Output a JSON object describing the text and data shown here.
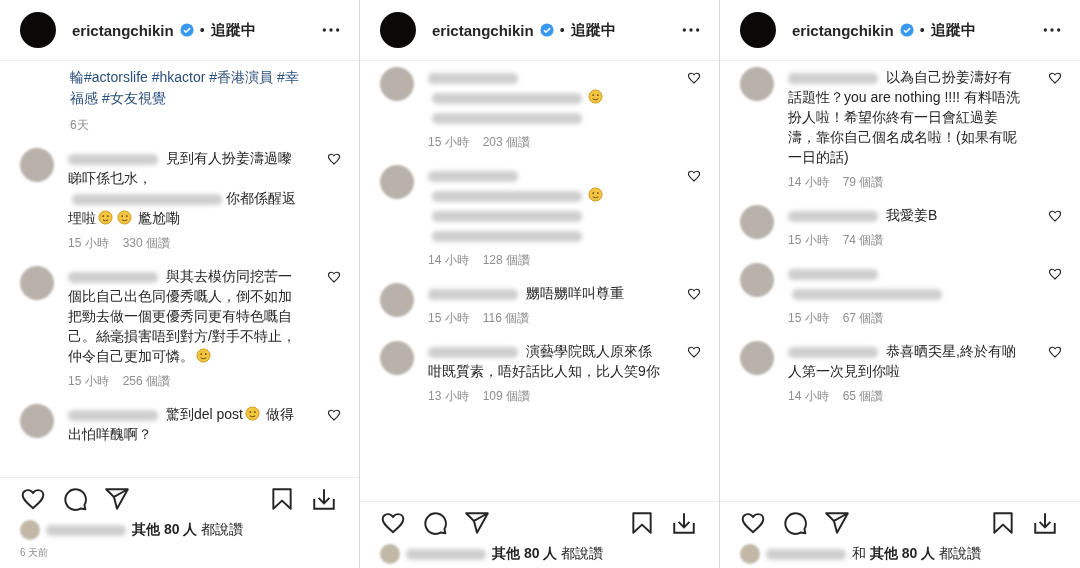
{
  "panels": [
    {
      "header": {
        "username": "erictangchikin",
        "separator": "•",
        "follow_status": "追蹤中"
      },
      "caption": "輪#actorslife #hkactor #香港演員 #幸福感 #女友視覺",
      "caption_time": "6天",
      "comments": [
        {
          "segments": [
            {
              "kind": "text",
              "text": "見到有人扮姜濤過嚟睇吓係乜水，"
            },
            {
              "kind": "blur"
            },
            {
              "kind": "text",
              "text": "你都係醒返埋啦"
            },
            {
              "kind": "emoji"
            },
            {
              "kind": "emoji"
            },
            {
              "kind": "text",
              "text": " 尷尬嘞"
            }
          ],
          "time": "15 小時",
          "likes": "330 個讚"
        },
        {
          "segments": [
            {
              "kind": "text",
              "text": "與其去模仿同挖苦一個比自己出色同優秀嘅人，倒不如加把勁去做一個更優秀同更有特色嘅自己。絲毫損害唔到對方/對手不特止，仲令自己更加可憐。"
            },
            {
              "kind": "emoji"
            }
          ],
          "time": "15 小時",
          "likes": "256 個讚"
        },
        {
          "segments": [
            {
              "kind": "text",
              "text": "驚到del post"
            },
            {
              "kind": "emoji"
            },
            {
              "kind": "text",
              "text": " 做得出怕咩醜啊？"
            }
          ]
        }
      ],
      "likes_text": "**其他 80 人** 都說讚",
      "date": "6 天前"
    },
    {
      "header": {
        "username": "erictangchikin",
        "separator": "•",
        "follow_status": "追蹤中"
      },
      "comments": [
        {
          "segments": [
            {
              "kind": "blur"
            },
            {
              "kind": "emoji"
            },
            {
              "kind": "blur"
            }
          ],
          "time": "15 小時",
          "likes": "203 個讚"
        },
        {
          "segments": [
            {
              "kind": "blur"
            },
            {
              "kind": "emoji"
            },
            {
              "kind": "blur"
            },
            {
              "kind": "blur"
            }
          ],
          "time": "14 小時",
          "likes": "128 個讚"
        },
        {
          "segments": [
            {
              "kind": "text",
              "text": "嬲唔嬲咩叫尊重"
            }
          ],
          "time": "15 小時",
          "likes": "116 個讚"
        },
        {
          "segments": [
            {
              "kind": "text",
              "text": "演藝學院既人原來係咁既質素，唔好話比人知，比人笑9你"
            }
          ],
          "time": "13 小時",
          "likes": "109 個讚"
        }
      ],
      "likes_text": "**其他 80 人** 都說讚"
    },
    {
      "header": {
        "username": "erictangchikin",
        "separator": "•",
        "follow_status": "追蹤中"
      },
      "comments": [
        {
          "segments": [
            {
              "kind": "text",
              "text": "以為自己扮姜濤好有話題性？you are nothing !!!! 有料唔洗扮人啦！希望你終有一日會紅過姜濤，靠你自己個名成名啦！(如果有呢一日的話)"
            }
          ],
          "time": "14 小時",
          "likes": "79 個讚"
        },
        {
          "segments": [
            {
              "kind": "text",
              "text": "我愛姜B"
            }
          ],
          "time": "15 小時",
          "likes": "74 個讚"
        },
        {
          "segments": [
            {
              "kind": "blur"
            }
          ],
          "time": "15 小時",
          "likes": "67 個讚"
        },
        {
          "segments": [
            {
              "kind": "text",
              "text": "恭喜晒奀星,終於有啲人第一次見到你啦"
            }
          ],
          "time": "14 小時",
          "likes": "65 個讚"
        }
      ],
      "likes_text": "和 **其他 80 人** 都說讚"
    }
  ]
}
